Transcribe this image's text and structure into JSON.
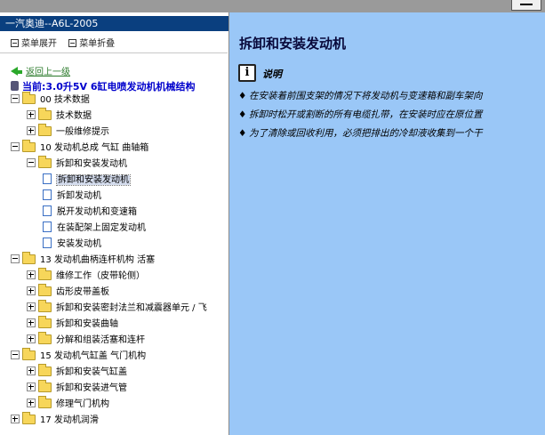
{
  "window": {
    "title_bar_button": "minimize"
  },
  "sidebar": {
    "title": "一汽奥迪--A6L-2005",
    "menu": [
      "菜单展开",
      "菜单折叠"
    ],
    "back_link": "返回上一级",
    "current_label": "当前:3.0升5V 6缸电喷发动机机械结构",
    "tree": [
      {
        "label": "00 技术数据",
        "type": "folder",
        "expander": "minus"
      },
      {
        "label": "技术数据",
        "type": "folder",
        "expander": "plus"
      },
      {
        "label": "一般维修提示",
        "type": "folder",
        "expander": "plus"
      },
      {
        "label": "10 发动机总成 气缸 曲轴箱",
        "type": "folder",
        "expander": "minus"
      },
      {
        "label": "拆卸和安装发动机",
        "type": "folder",
        "expander": "minus"
      },
      {
        "label": "拆卸和安装发动机",
        "type": "doc",
        "selected": true
      },
      {
        "label": "拆卸发动机",
        "type": "doc"
      },
      {
        "label": "脱开发动机和变速箱",
        "type": "doc"
      },
      {
        "label": "在装配架上固定发动机",
        "type": "doc"
      },
      {
        "label": "安装发动机",
        "type": "doc"
      },
      {
        "label": "13 发动机曲柄连杆机构 活塞",
        "type": "folder",
        "expander": "minus"
      },
      {
        "label": "维修工作（皮带轮侧）",
        "type": "folder",
        "expander": "plus"
      },
      {
        "label": "齿形皮带盖板",
        "type": "folder",
        "expander": "plus"
      },
      {
        "label": "拆卸和安装密封法兰和减震器单元 / 飞",
        "type": "folder",
        "expander": "plus"
      },
      {
        "label": "拆卸和安装曲轴",
        "type": "folder",
        "expander": "plus"
      },
      {
        "label": "分解和组装活塞和连杆",
        "type": "folder",
        "expander": "plus"
      },
      {
        "label": "15 发动机气缸盖 气门机构",
        "type": "folder",
        "expander": "minus"
      },
      {
        "label": "拆卸和安装气缸盖",
        "type": "folder",
        "expander": "plus"
      },
      {
        "label": "拆卸和安装进气管",
        "type": "folder",
        "expander": "plus"
      },
      {
        "label": "修理气门机构",
        "type": "folder",
        "expander": "plus"
      },
      {
        "label": "17 发动机润滑",
        "type": "folder",
        "expander": "plus"
      }
    ]
  },
  "content": {
    "title": "拆卸和安装发动机",
    "note_icon": "info-icon",
    "note_label": "说明",
    "bullets": [
      "在安装着前围支架的情况下将发动机与变速箱和副车架向",
      "拆卸时松开或割断的所有电缆扎带，在安装时应在原位置",
      "为了清除或回收利用，必须把排出的冷却液收集到一个干"
    ]
  },
  "colors": {
    "title_bar": "#0a3f7f",
    "content_bg": "#9ac7f7",
    "current_label": "#0000cc",
    "back_link": "#2a7a2a"
  }
}
